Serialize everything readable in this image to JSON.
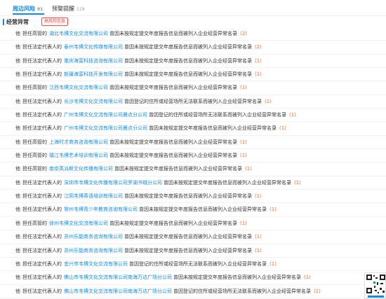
{
  "tabs": [
    {
      "label": "周边风险",
      "count": "81"
    },
    {
      "label": "预警提醒",
      "count": "119"
    }
  ],
  "section": {
    "title": "经营异常",
    "badge": "高风险信息"
  },
  "rows": [
    {
      "name": "他",
      "role": "担任高管的",
      "company": "湖北韦博文化交流有限公司",
      "reason": "曾因未按规定提交年度报告信息而被列入企业经营异常名录",
      "count": "(2)"
    },
    {
      "name": "他",
      "role": "担任法定代表人的",
      "company": "泰州韦博文化传媒有限公司",
      "reason": "曾因未按规定提交年度报告信息而被列入企业经营异常名录",
      "count": "(2)"
    },
    {
      "name": "他",
      "role": "担任法定代表人的",
      "company": "重庆海富科技咨询有限公司",
      "reason": "曾因未按规定提交年度报告信息而被列入企业经营异常名录",
      "count": "(1)"
    },
    {
      "name": "他",
      "role": "担任法定代表人的",
      "company": "新疆海富科技开发有限公司",
      "reason": "曾因未按规定提交年度报告信息而被列入企业经营异常名录",
      "count": "(1)"
    },
    {
      "name": "他",
      "role": "担任高管的",
      "company": "江西韦博文化交流有限公司",
      "reason": "曾因未按规定提交年度报告信息而被列入企业经营异常名录",
      "count": "(1)"
    },
    {
      "name": "他",
      "role": "担任法定代表人的",
      "company": "长沙韦博文化交流有限公司",
      "reason": "曾因登记的住所或经营场所无法联系而被列入企业经营异常名录",
      "count": "(1)"
    },
    {
      "name": "他",
      "role": "担任法定代表人的",
      "company": "广州韦博文化交流有限公司晨点分公司",
      "reason": "曾因登记的住所或经营场所无法联系而被列入企业经营异常名录",
      "count": "(1)"
    },
    {
      "name": "他",
      "role": "担任法定代表人的",
      "company": "广州韦博文化交流有限公司晨点分公司",
      "reason": "曾因未按规定提交年度报告信息而被列入企业经营异常名录",
      "count": "(1)"
    },
    {
      "name": "他",
      "role": "担任高管的",
      "company": "上海时才商务咨询有限公司",
      "reason": "曾因未按规定提交年度报告信息而被列入企业经营异常名录",
      "count": "(1)"
    },
    {
      "name": "他",
      "role": "担任高管的",
      "company": "镇江韦博艺术培训有限公司",
      "reason": "曾因未按规定提交年度报告信息而被列入企业经营异常名录",
      "count": "(1)"
    },
    {
      "name": "他",
      "role": "担任高管的",
      "company": "南京英派斯文化传播有限公司",
      "reason": "曾因未按规定提交年度报告信息而被列入企业经营异常名录",
      "count": "(1)"
    },
    {
      "name": "他",
      "role": "担任法定代表人的",
      "company": "深圳市韦博文化传播有限公司罗湖书城分公司",
      "reason": "曾因未按规定提交年度报告信息而被列入企业经营异常名录",
      "count": "(1)"
    },
    {
      "name": "他",
      "role": "担任法定代表人的",
      "company": "江阴韦博英语培训有限公司",
      "reason": "曾因未按规定提交年度报告信息而被列入企业经营异常名录",
      "count": "(1)"
    },
    {
      "name": "他",
      "role": "担任法定代表人的",
      "company": "常州韦博青少年教育咨询有限公司",
      "reason": "曾因未按规定提交年度报告信息而被列入企业经营异常名录",
      "count": "(1)"
    },
    {
      "name": "他",
      "role": "担任高管的",
      "company": "徐州韦博文化交流有限公司",
      "reason": "曾因未按规定提交年度报告信息而被列入企业经营异常名录",
      "count": "(1)"
    },
    {
      "name": "他",
      "role": "担任法定代表人的",
      "company": "苏州乐能商务咨询有限公司",
      "reason": "曾因未按规定提交年度报告信息而被列入企业经营异常名录",
      "count": "(1)"
    },
    {
      "name": "他",
      "role": "担任法定代表人的",
      "company": "苏州乐能商务咨询有限公司",
      "reason": "曾因未按规定提交年度报告信息而被列入企业经营异常名录",
      "count": "(1)"
    },
    {
      "name": "他",
      "role": "担任法定代表人的",
      "company": "宜兴市韦博文化交流有限公司",
      "reason": "曾因登记的住所或经营场所无法联系而被列入企业经营异常名录",
      "count": "(1)"
    },
    {
      "name": "他",
      "role": "担任法定代表人的",
      "company": "佛山市韦博文化交流有限公司南海万达广场分公司",
      "reason": "曾因未按规定提交年度报告信息而被列入企业经营异常名录",
      "count": "(1)"
    },
    {
      "name": "他",
      "role": "担任法定代表人的",
      "company": "佛山市韦博文化交流有限公司南海万达广场分公司",
      "reason": "曾因登记的住所或经营场所无法联系而被列入企业经营异常名录",
      "count": "(1)"
    }
  ]
}
